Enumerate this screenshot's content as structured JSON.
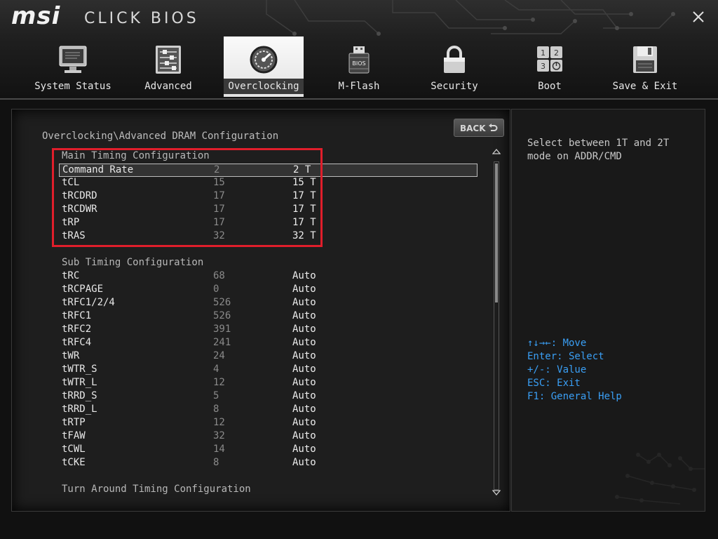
{
  "app": {
    "brand": "msi",
    "product": "CLICK BIOS"
  },
  "tabs": [
    {
      "label": "System Status",
      "icon": "monitor-icon",
      "active": false
    },
    {
      "label": "Advanced",
      "icon": "sliders-icon",
      "active": false
    },
    {
      "label": "Overclocking",
      "icon": "gauge-icon",
      "active": true
    },
    {
      "label": "M-Flash",
      "icon": "usb-bios-icon",
      "active": false
    },
    {
      "label": "Security",
      "icon": "lock-icon",
      "active": false
    },
    {
      "label": "Boot",
      "icon": "boot-order-icon",
      "active": false
    },
    {
      "label": "Save & Exit",
      "icon": "floppy-icon",
      "active": false
    }
  ],
  "main": {
    "breadcrumb": "Overclocking\\Advanced DRAM Configuration",
    "back_label": "BACK",
    "main_timing_title": "Main Timing Configuration",
    "main_timing": [
      {
        "name": "Command Rate",
        "current": "2",
        "value": "2 T"
      },
      {
        "name": "tCL",
        "current": "15",
        "value": "15 T"
      },
      {
        "name": "tRCDRD",
        "current": "17",
        "value": "17 T"
      },
      {
        "name": "tRCDWR",
        "current": "17",
        "value": "17 T"
      },
      {
        "name": "tRP",
        "current": "17",
        "value": "17 T"
      },
      {
        "name": "tRAS",
        "current": "32",
        "value": "32 T"
      }
    ],
    "sub_timing_title": "Sub Timing Configuration",
    "sub_timing": [
      {
        "name": "tRC",
        "current": "68",
        "value": "Auto"
      },
      {
        "name": "tRCPAGE",
        "current": "0",
        "value": "Auto"
      },
      {
        "name": "tRFC1/2/4",
        "current": "526",
        "value": "Auto"
      },
      {
        "name": "tRFC1",
        "current": "526",
        "value": "Auto"
      },
      {
        "name": "tRFC2",
        "current": "391",
        "value": "Auto"
      },
      {
        "name": "tRFC4",
        "current": "241",
        "value": "Auto"
      },
      {
        "name": "tWR",
        "current": "24",
        "value": "Auto"
      },
      {
        "name": "tWTR_S",
        "current": "4",
        "value": "Auto"
      },
      {
        "name": "tWTR_L",
        "current": "12",
        "value": "Auto"
      },
      {
        "name": "tRRD_S",
        "current": "5",
        "value": "Auto"
      },
      {
        "name": "tRRD_L",
        "current": "8",
        "value": "Auto"
      },
      {
        "name": "tRTP",
        "current": "12",
        "value": "Auto"
      },
      {
        "name": "tFAW",
        "current": "32",
        "value": "Auto"
      },
      {
        "name": "tCWL",
        "current": "14",
        "value": "Auto"
      },
      {
        "name": "tCKE",
        "current": "8",
        "value": "Auto"
      }
    ],
    "turn_around_title": "Turn Around Timing Configuration"
  },
  "help": {
    "description": "Select between 1T and 2T\nmode on ADDR/CMD",
    "keys": [
      "↑↓→←: Move",
      "Enter: Select",
      "+/-: Value",
      "ESC: Exit",
      "F1: General Help"
    ]
  },
  "colors": {
    "highlight": "#e01e2b",
    "key_help": "#3a9ff5"
  }
}
